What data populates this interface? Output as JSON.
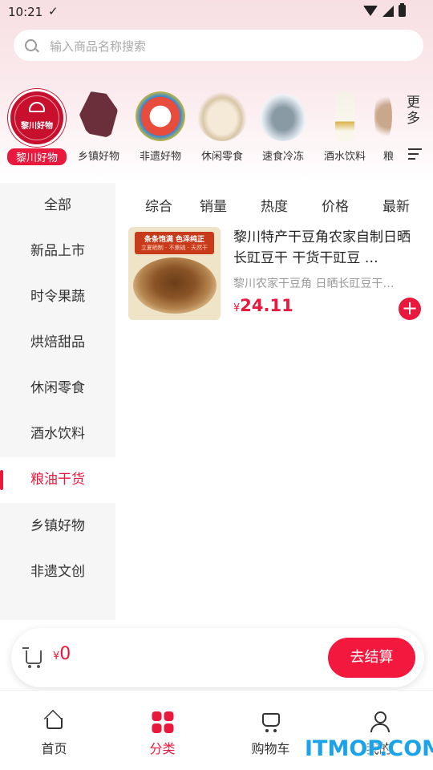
{
  "status_bar": {
    "time": "10:21",
    "check_icon": "check-icon"
  },
  "search": {
    "placeholder": "输入商品名称搜索"
  },
  "categories": [
    {
      "label": "黎川好物",
      "logo_text": "黎川好物",
      "icon": "lichuan-logo-icon",
      "active": true
    },
    {
      "label": "乡镇好物",
      "icon": "map-icon"
    },
    {
      "label": "非遗好物",
      "icon": "lion-dance-icon"
    },
    {
      "label": "休闲零食",
      "icon": "snack-icon"
    },
    {
      "label": "速食冷冻",
      "icon": "frozen-food-icon"
    },
    {
      "label": "酒水饮料",
      "icon": "drink-bottle-icon"
    },
    {
      "label": "粮",
      "icon": "grain-icon"
    }
  ],
  "more": {
    "label": "更多"
  },
  "sidebar": {
    "items": [
      {
        "label": "全部"
      },
      {
        "label": "新品上市"
      },
      {
        "label": "时令果蔬"
      },
      {
        "label": "烘焙甜品"
      },
      {
        "label": "休闲零食"
      },
      {
        "label": "酒水饮料"
      },
      {
        "label": "粮油干货",
        "active": true
      },
      {
        "label": "乡镇好物"
      },
      {
        "label": "非遗文创"
      }
    ]
  },
  "sort_tabs": [
    "综合",
    "销量",
    "热度",
    "价格",
    "最新"
  ],
  "products": [
    {
      "title": "黎川特产干豆角农家自制日晒长豇豆干 干货干豇豆 …",
      "description": "黎川农家干豆角 日晒长豇豆干…",
      "image_banner": "条条饱满 色泽纯正",
      "image_banner_sub": "立夏晒制 · 不熏硫 · 天然干",
      "currency": "¥",
      "price": "24.11",
      "add_label": "+"
    }
  ],
  "cart": {
    "currency": "¥",
    "total": "0",
    "checkout_label": "去结算"
  },
  "bottom_nav": [
    {
      "label": "首页",
      "icon": "home-icon"
    },
    {
      "label": "分类",
      "icon": "category-icon",
      "active": true
    },
    {
      "label": "购物车",
      "icon": "cart-icon"
    },
    {
      "label": "我的",
      "icon": "profile-icon"
    }
  ],
  "watermark": "ITMOP.COM",
  "colors": {
    "accent": "#e8193c",
    "brand": "#c8102e",
    "checkout": "#f3183e",
    "watermark": "#1aa3e8"
  }
}
